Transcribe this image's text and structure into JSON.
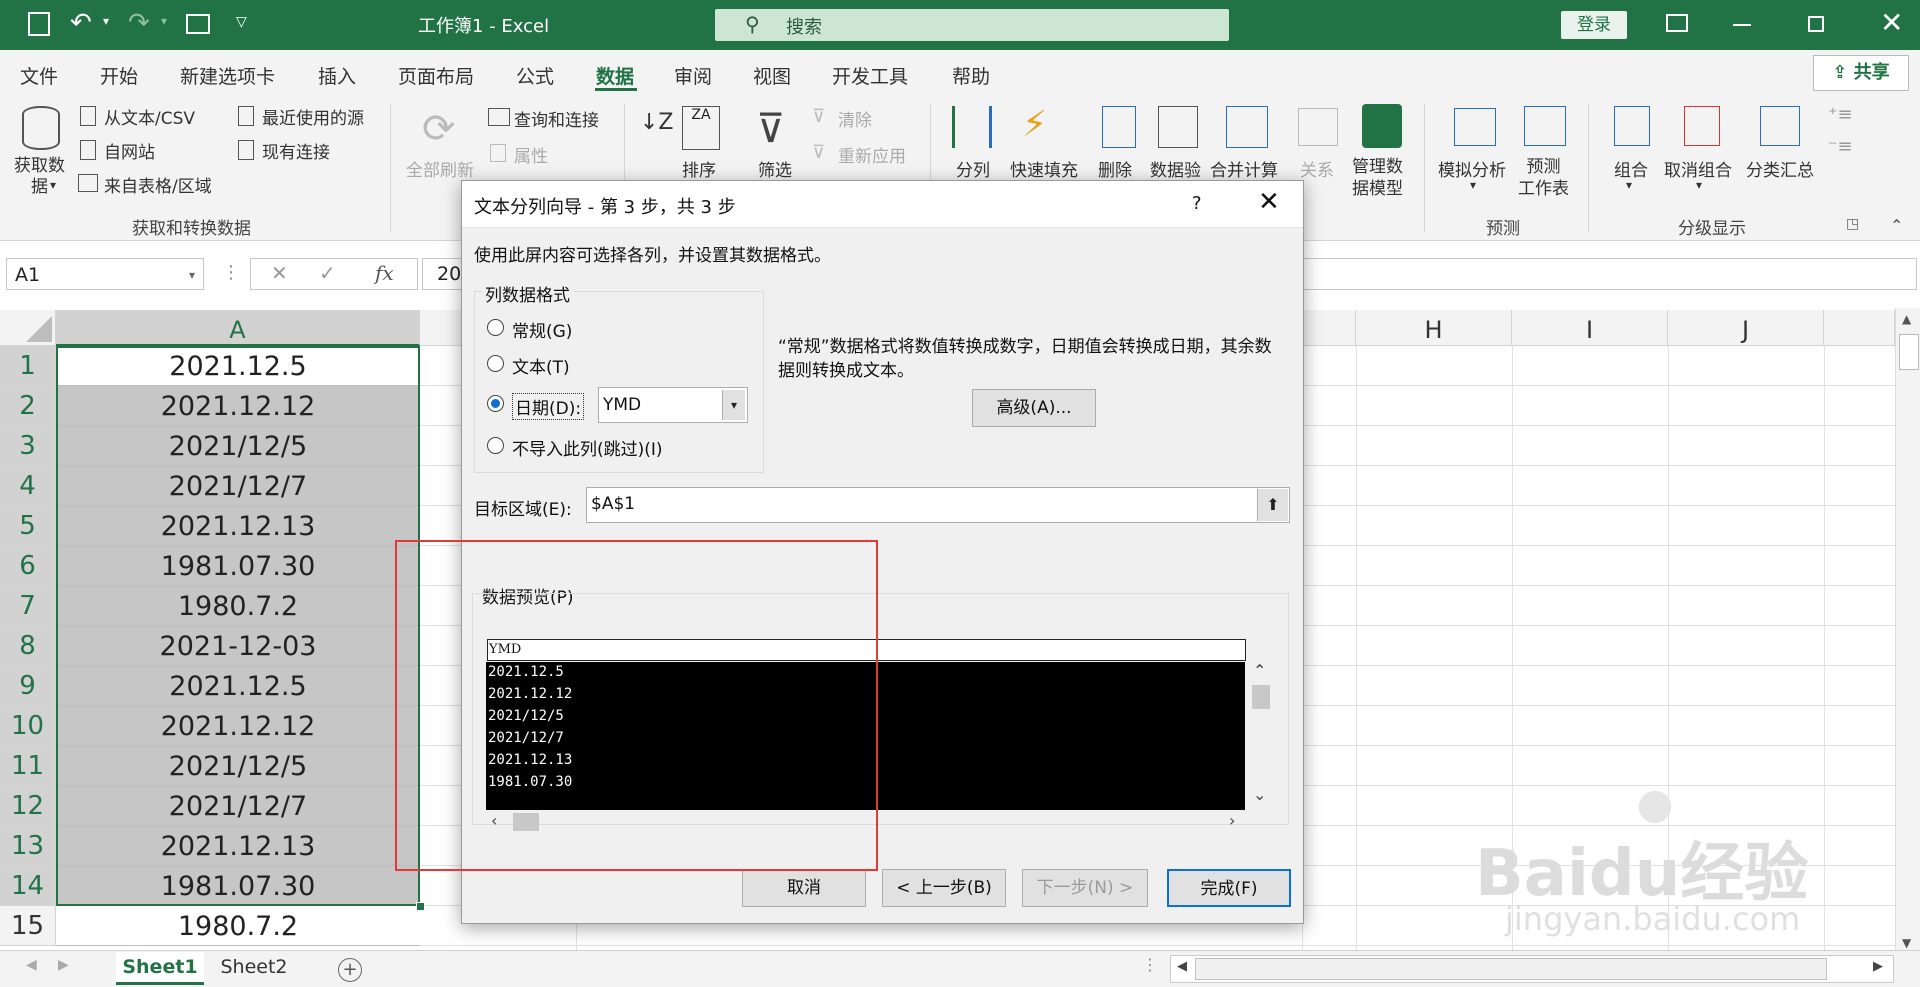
{
  "title_bar": {
    "title": "工作簿1 - Excel",
    "search_placeholder": "搜索",
    "login_label": "登录"
  },
  "menu": {
    "items": [
      "文件",
      "开始",
      "新建选项卡",
      "插入",
      "页面布局",
      "公式",
      "数据",
      "审阅",
      "视图",
      "开发工具",
      "帮助"
    ],
    "active": "数据",
    "share_label": "共享"
  },
  "ribbon": {
    "get_data": {
      "get_data_label": "获取数\n据",
      "from_text_csv": "从文本/CSV",
      "from_web": "自网站",
      "from_table": "来自表格/区域",
      "recent_sources": "最近使用的源",
      "existing_connections": "现有连接",
      "group_label": "获取和转换数据"
    },
    "queries": {
      "refresh_all": "全部刷新",
      "queries_connections": "查询和连接",
      "properties": "属性"
    },
    "sort_filter": {
      "sort": "排序",
      "filter": "筛选",
      "clear": "清除",
      "reapply": "重新应用"
    },
    "data_tools": {
      "split": "分列",
      "flash_fill": "快速填充",
      "remove": "删除",
      "validate": "数据验",
      "consolidate": "合并计算",
      "relationships": "关系",
      "manage_model": "管理数\n据模型"
    },
    "forecast": {
      "what_if": "模拟分析",
      "forecast_sheet": "预测\n工作表",
      "group_label": "预测"
    },
    "outline": {
      "group": "组合",
      "ungroup": "取消组合",
      "subtotal": "分类汇总",
      "group_label": "分级显示"
    }
  },
  "formula_bar": {
    "name_box": "A1",
    "cancel_glyph": "✕",
    "enter_glyph": "✓",
    "fx_label": "fx",
    "value": "20"
  },
  "sheet": {
    "column_headers": [
      "A",
      "H",
      "I",
      "J"
    ],
    "rows": [
      {
        "num": "1",
        "a": "2021.12.5"
      },
      {
        "num": "2",
        "a": "2021.12.12"
      },
      {
        "num": "3",
        "a": "2021/12/5"
      },
      {
        "num": "4",
        "a": "2021/12/7"
      },
      {
        "num": "5",
        "a": "2021.12.13"
      },
      {
        "num": "6",
        "a": "1981.07.30"
      },
      {
        "num": "7",
        "a": "1980.7.2"
      },
      {
        "num": "8",
        "a": "2021-12-03"
      },
      {
        "num": "9",
        "a": "2021.12.5"
      },
      {
        "num": "10",
        "a": "2021.12.12"
      },
      {
        "num": "11",
        "a": "2021/12/5"
      },
      {
        "num": "12",
        "a": "2021/12/7"
      },
      {
        "num": "13",
        "a": "2021.12.13"
      },
      {
        "num": "14",
        "a": "1981.07.30"
      },
      {
        "num": "15",
        "a": "1980.7.2"
      }
    ],
    "tabs": [
      "Sheet1",
      "Sheet2"
    ],
    "active_tab": "Sheet1"
  },
  "dialog": {
    "title": "文本分列向导 - 第 3 步，共 3 步",
    "help_glyph": "?",
    "instruction": "使用此屏内容可选择各列，并设置其数据格式。",
    "column_format_label": "列数据格式",
    "options": [
      {
        "label": "常规(G)",
        "checked": false
      },
      {
        "label": "文本(T)",
        "checked": false
      },
      {
        "label": "日期(D):",
        "checked": true
      },
      {
        "label": "不导入此列(跳过)(I)",
        "checked": false
      }
    ],
    "date_format_value": "YMD",
    "description": "“常规”数据格式将数值转换成数字，日期值会转换成日期，其余数据则转换成文本。",
    "advanced_button": "高级(A)...",
    "destination_label": "目标区域(E):",
    "destination_value": "$A$1",
    "preview_label": "数据预览(P)",
    "preview_header": "YMD",
    "preview_rows": [
      "2021.12.5",
      "2021.12.12",
      "2021/12/5",
      "2021/12/7",
      "2021.12.13",
      "1981.07.30"
    ],
    "buttons": {
      "cancel": "取消",
      "back": "< 上一步(B)",
      "next": "下一步(N) >",
      "finish": "完成(F)"
    }
  },
  "colors": {
    "excel_green": "#217346",
    "selection_gray": "#c6c6c6",
    "highlight_red": "#e53935",
    "dialog_blue": "#0a6fd6"
  },
  "watermark": {
    "brand": "Baidu经验",
    "url": "jingyan.baidu.com"
  }
}
